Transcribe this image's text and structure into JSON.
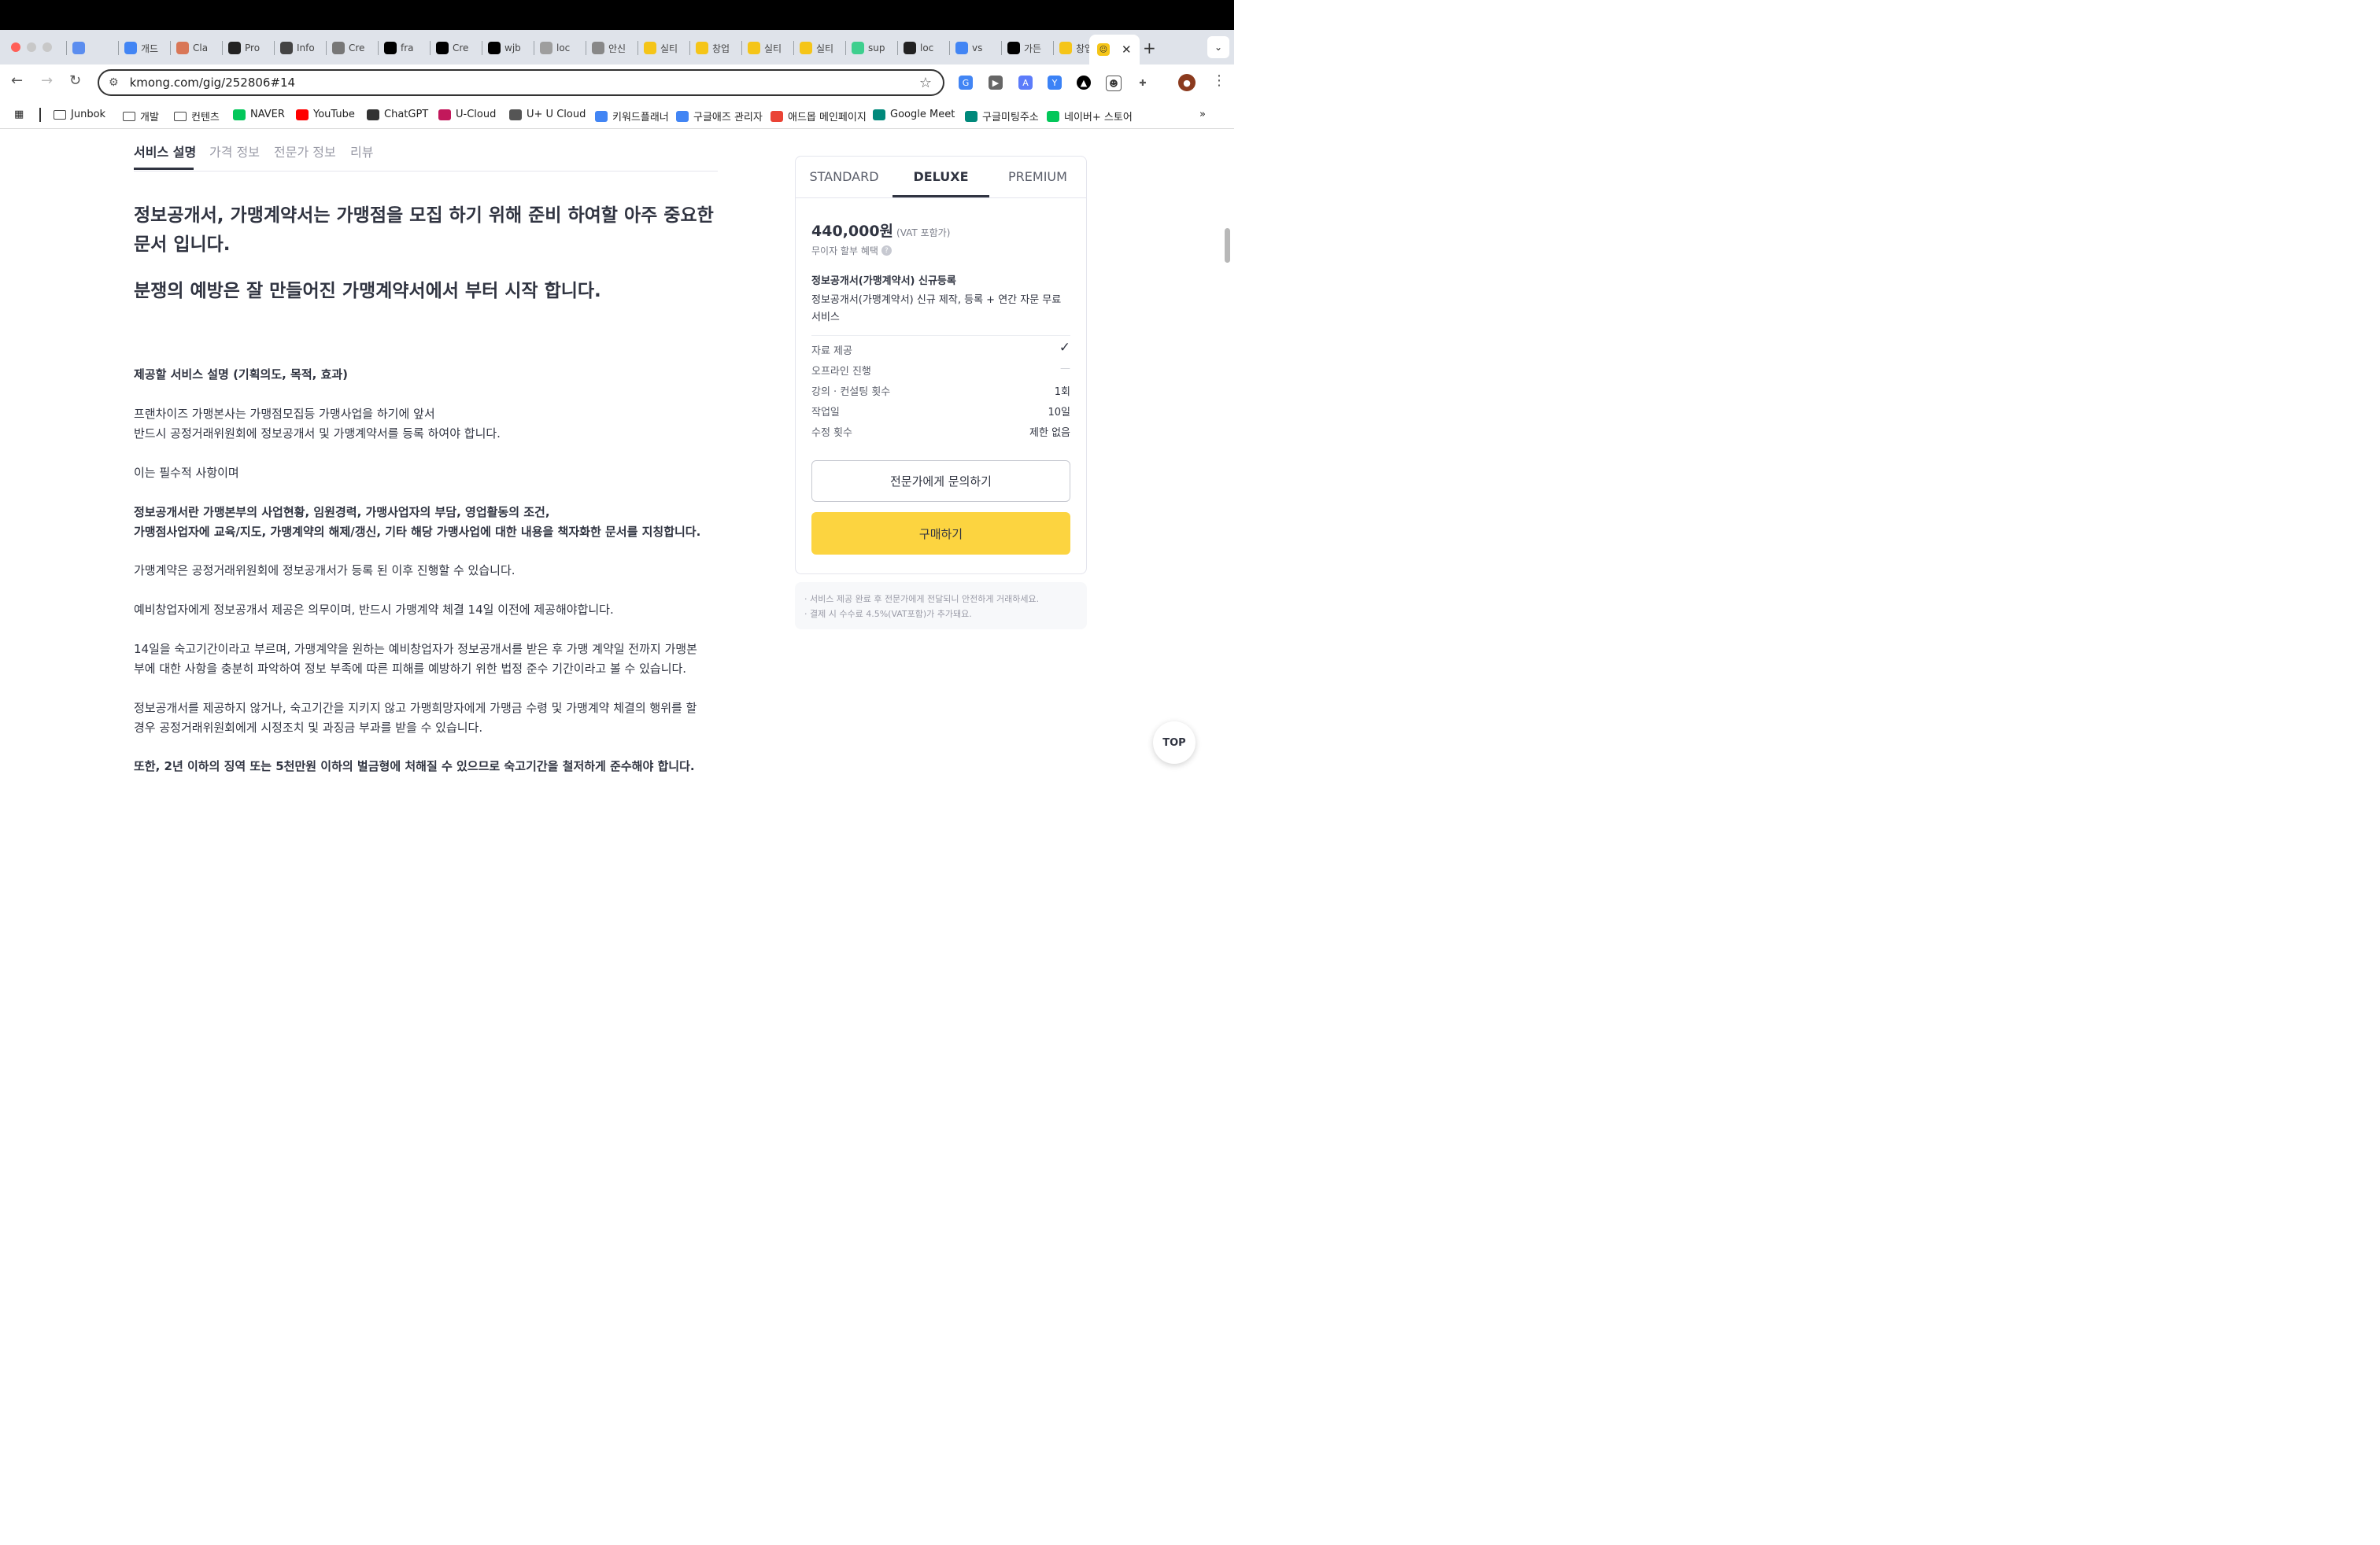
{
  "browser": {
    "tabs": [
      {
        "label": "",
        "color": "#5b8def"
      },
      {
        "label": "개드",
        "color": "#4285f4"
      },
      {
        "label": "Cla",
        "color": "#d97757"
      },
      {
        "label": "Pro",
        "color": "#222222"
      },
      {
        "label": "Info",
        "color": "#444444"
      },
      {
        "label": "Cre",
        "color": "#777777"
      },
      {
        "label": "fra",
        "color": "#000000"
      },
      {
        "label": "Cre",
        "color": "#000000"
      },
      {
        "label": "wjb",
        "color": "#000000"
      },
      {
        "label": "loc",
        "color": "#9e9e9e"
      },
      {
        "label": "안신",
        "color": "#888888"
      },
      {
        "label": "실티",
        "color": "#f5c518"
      },
      {
        "label": "창업",
        "color": "#f5c518"
      },
      {
        "label": "실티",
        "color": "#f5c518"
      },
      {
        "label": "실티",
        "color": "#f5c518"
      },
      {
        "label": "sup",
        "color": "#3ecf8e"
      },
      {
        "label": "loc",
        "color": "#222222"
      },
      {
        "label": "vs",
        "color": "#4285f4"
      },
      {
        "label": "가든",
        "color": "#000000"
      },
      {
        "label": "창업",
        "color": "#f5c518"
      }
    ],
    "active_tab_color": "#f5c518",
    "url": "kmong.com/gig/252806#14",
    "bookmarks": [
      {
        "label": "Junbok",
        "icon": "folder-icon"
      },
      {
        "label": "개발",
        "icon": "folder-icon"
      },
      {
        "label": "컨텐츠",
        "icon": "folder-icon"
      },
      {
        "label": "NAVER",
        "icon": "naver-icon",
        "color": "#03c75a"
      },
      {
        "label": "YouTube",
        "icon": "youtube-icon",
        "color": "#ff0000"
      },
      {
        "label": "ChatGPT",
        "icon": "chatgpt-icon",
        "color": "#333333"
      },
      {
        "label": "U-Cloud",
        "icon": "ucloud-icon",
        "color": "#c2185b"
      },
      {
        "label": "U+ U Cloud",
        "icon": "cloud-icon",
        "color": "#555555"
      },
      {
        "label": "키워드플래너",
        "icon": "google-ads-icon",
        "color": "#4285f4"
      },
      {
        "label": "구글애즈 관리자",
        "icon": "google-ads-icon",
        "color": "#4285f4"
      },
      {
        "label": "애드몹 메인페이지",
        "icon": "admob-icon",
        "color": "#ea4335"
      },
      {
        "label": "Google Meet",
        "icon": "meet-icon",
        "color": "#00897b"
      },
      {
        "label": "구글미팅주소",
        "icon": "meet-icon",
        "color": "#00897b"
      },
      {
        "label": "네이버+ 스토어",
        "icon": "naver-store-icon",
        "color": "#03c75a"
      }
    ]
  },
  "page": {
    "tabs": [
      "서비스 설명",
      "가격 정보",
      "전문가 정보",
      "리뷰"
    ],
    "headline1_line1": "정보공개서, 가맹계약서는 가맹점을 모집 하기 위해 준비 하여할 아주 중요한",
    "headline1_line2": "문서 입니다.",
    "headline2": "분쟁의 예방은 잘 만들어진 가맹계약서에서 부터 시작 합니다.",
    "section_title": "제공할 서비스 설명 (기획의도, 목적, 효과)",
    "para1_line1": "프랜차이즈 가맹본사는 가맹점모집등 가맹사업을 하기에 앞서",
    "para1_line2": "반드시 공정거래위원회에 정보공개서 및 가맹계약서를 등록 하여야 합니다.",
    "para2": "이는 필수적 사항이며",
    "para3_line1": "정보공개서란 가맹본부의 사업현황, 임원경력, 가맹사업자의 부담, 영업활동의 조건,",
    "para3_line2": "가맹점사업자에 교육/지도, 가맹계약의 해제/갱신, 기타 해당 가맹사업에 대한 내용을 책자화한 문서를 지칭합니다.",
    "para4": "가맹계약은 공정거래위원회에 정보공개서가 등록 된 이후 진행할 수 있습니다.",
    "para5": "예비창업자에게 정보공개서 제공은 의무이며, 반드시 가맹계약 체결 14일 이전에 제공해야합니다.",
    "para6_line1": "14일을 숙고기간이라고 부르며, 가맹계약을 원하는 예비창업자가 정보공개서를 받은 후 가맹 계약일 전까지 가맹본",
    "para6_line2": "부에 대한 사항을 충분히 파악하여 정보 부족에 따른 피해를 예방하기 위한 법정 준수 기간이라고 볼 수 있습니다.",
    "para7_line1": "정보공개서를 제공하지 않거나, 숙고기간을 지키지 않고 가맹희망자에게 가맹금 수령 및 가맹계약 체결의 행위를 할",
    "para7_line2": "경우 공정거래위원회에게 시정조치 및 과징금 부과를 받을 수 있습니다.",
    "para8": "또한, 2년 이하의 징역 또는 5천만원 이하의 벌금형에 처해질 수 있으므로 숙고기간을 철저하게 준수해야 합니다."
  },
  "pricing": {
    "tabs": [
      "STANDARD",
      "DELUXE",
      "PREMIUM"
    ],
    "active_tab": "DELUXE",
    "price": "440,000원",
    "vat_note": "(VAT 포함가)",
    "installment": "무이자 할부 혜택",
    "package_title": "정보공개서(가맹계약서) 신규등록",
    "package_desc": "정보공개서(가맹계약서) 신규 제작, 등록  + 연간 자문 무료 서비스",
    "features": [
      {
        "label": "자료 제공",
        "value": "✓"
      },
      {
        "label": "오프라인 진행",
        "value": "—"
      },
      {
        "label": "강의 · 컨설팅 횟수",
        "value": "1회"
      },
      {
        "label": "작업일",
        "value": "10일"
      },
      {
        "label": "수정 횟수",
        "value": "제한 없음"
      }
    ],
    "contact_button": "전문가에게 문의하기",
    "buy_button": "구매하기",
    "buy_color": "#fcd440",
    "notice1": "· 서비스 제공 완료 후 전문가에게 전달되니 안전하게 거래하세요.",
    "notice2": "· 결제 시 수수료 4.5%(VAT포함)가 추가돼요."
  },
  "top_button": "TOP"
}
